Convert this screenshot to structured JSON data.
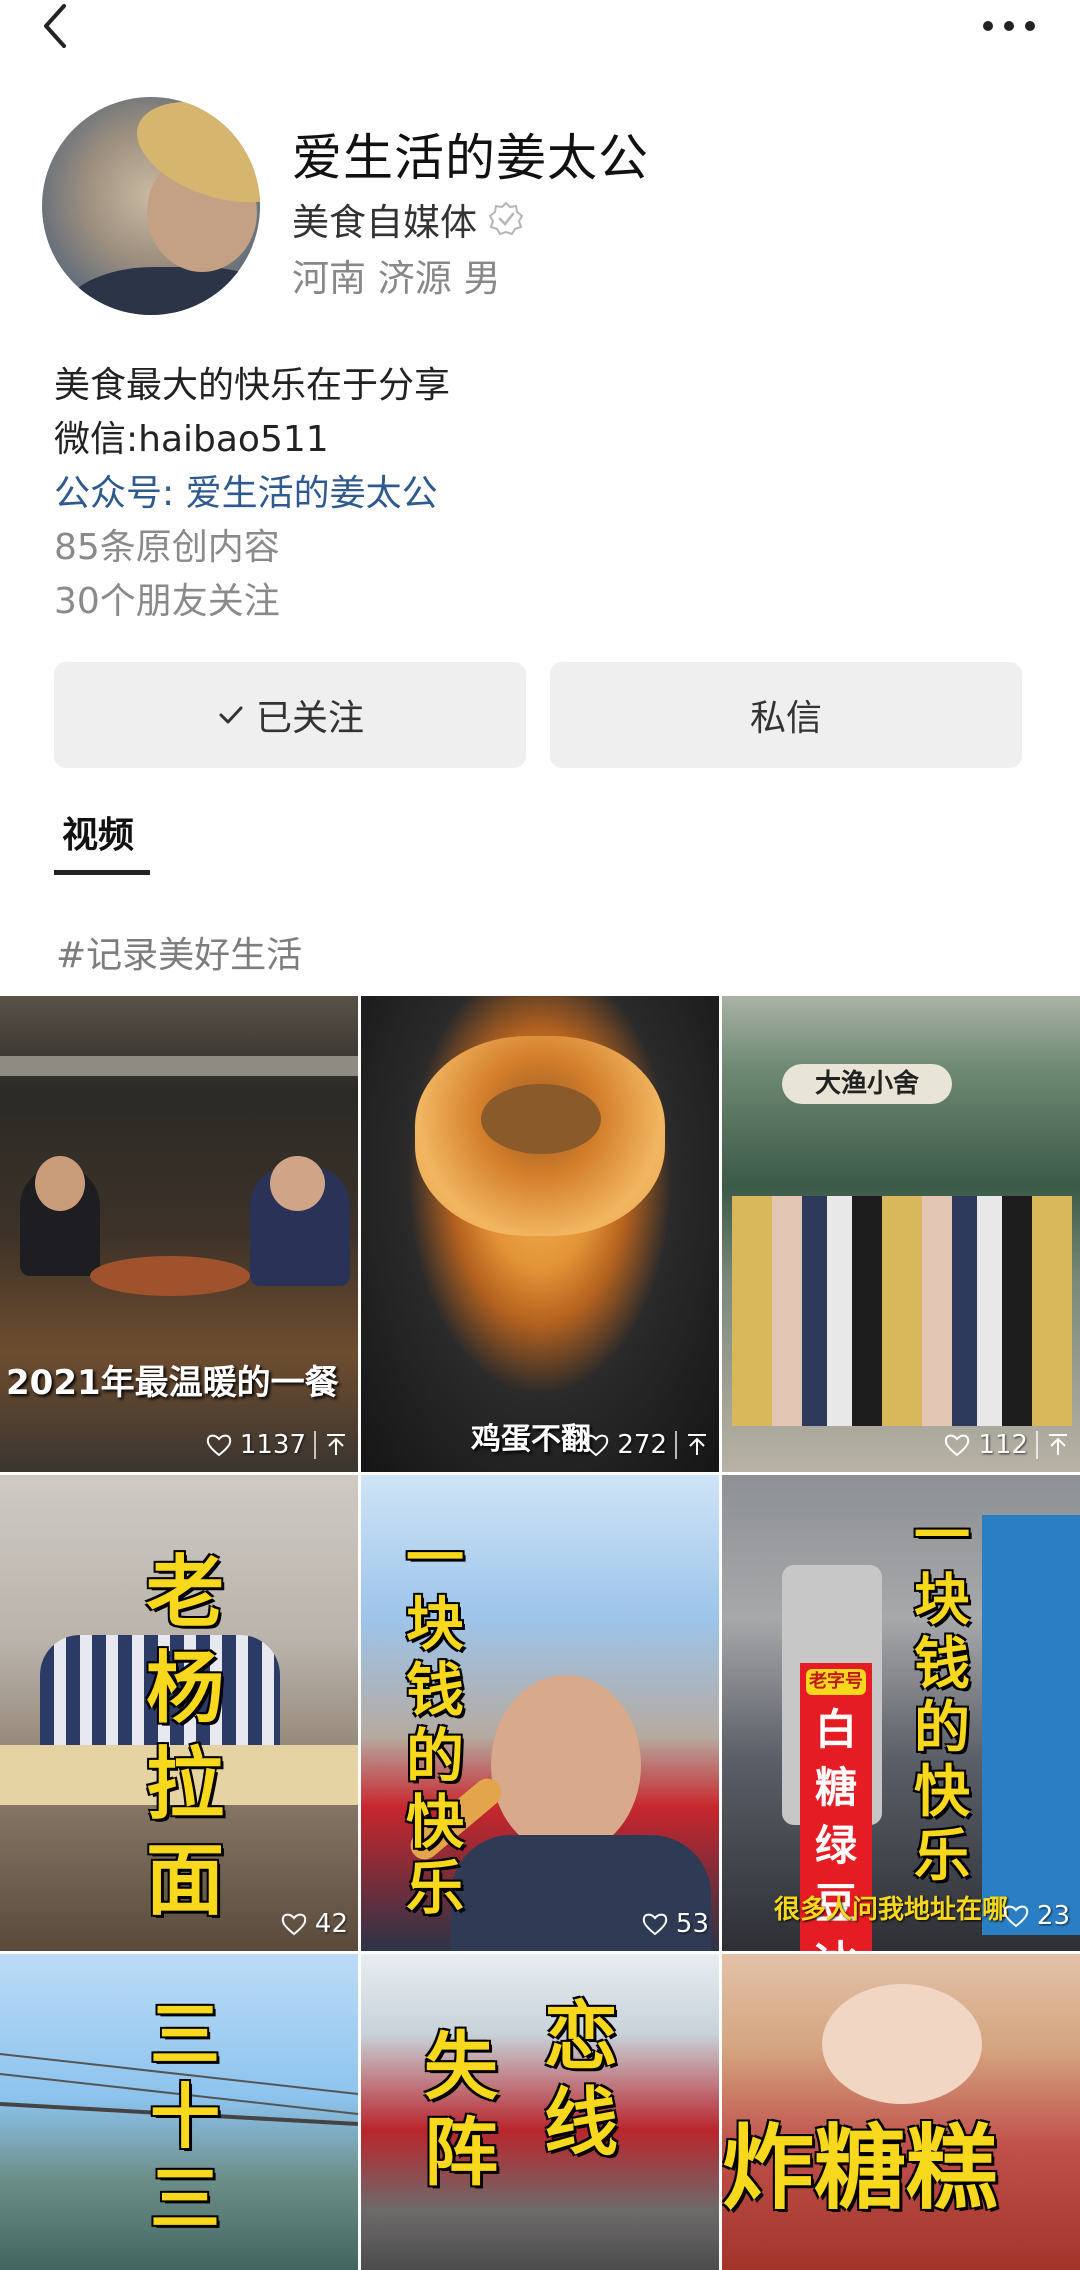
{
  "profile": {
    "name": "爱生活的姜太公",
    "category": "美食自媒体",
    "location": "河南 济源 男",
    "bio_line1": "美食最大的快乐在于分享",
    "bio_line2": "微信:haibao511",
    "bio_line3": "公众号: 爱生活的姜太公",
    "original_count": "85条原创内容",
    "friends_following": "30个朋友关注"
  },
  "actions": {
    "follow_label": "已关注",
    "message_label": "私信"
  },
  "tabs": {
    "video_label": "视频"
  },
  "hashtag": "#记录美好生活",
  "videos": [
    {
      "caption": "2021年最温暖的一餐",
      "likes": "1137"
    },
    {
      "caption": "鸡蛋不翻",
      "likes": "272"
    },
    {
      "caption": "",
      "sign": "大渔小舍",
      "likes": "112"
    },
    {
      "overlay": "老杨拉面",
      "likes": "42"
    },
    {
      "overlay": "一块钱的快乐",
      "likes": "53"
    },
    {
      "overlay": "一块钱的快乐",
      "sign_top": "老字号",
      "sign": "白糖绿豆冰",
      "subtitle": "很多人问我地址在哪",
      "likes": "23"
    },
    {
      "overlay": "三十三"
    },
    {
      "overlay_a": "失阵",
      "overlay_b": "恋线"
    },
    {
      "overlay": "炸糖糕"
    }
  ],
  "colors": {
    "link": "#2f5a8f",
    "button_bg": "#efefef",
    "overlay_yellow": "#f8d81c"
  }
}
